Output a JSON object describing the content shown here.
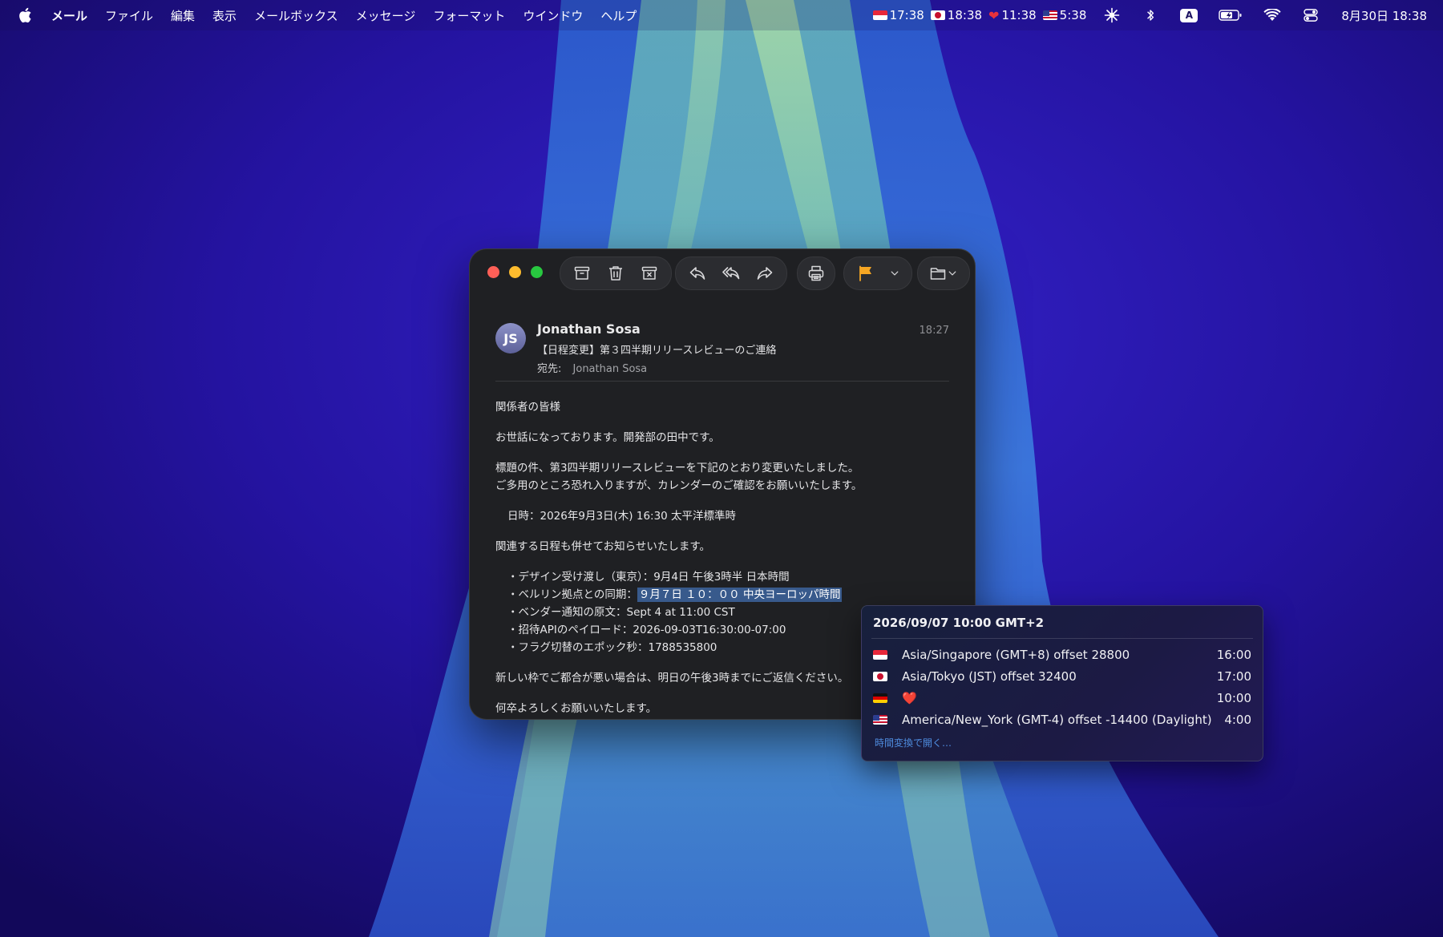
{
  "menubar": {
    "app_name": "メール",
    "items": [
      "ファイル",
      "編集",
      "表示",
      "メールボックス",
      "メッセージ",
      "フォーマット",
      "ウインドウ",
      "ヘルプ"
    ],
    "world_clocks": [
      {
        "flag": "flag-sg",
        "time": "17:38"
      },
      {
        "flag": "flag-jp",
        "time": "18:38"
      },
      {
        "flag": "heart",
        "time": "11:38"
      },
      {
        "flag": "flag-us",
        "time": "5:38"
      }
    ],
    "input_source": "A",
    "datetime": "8月30日 18:38"
  },
  "mail": {
    "sender_initials": "JS",
    "sender": "Jonathan Sosa",
    "time": "18:27",
    "subject": "【日程変更】第３四半期リリースレビューのご連絡",
    "to_label": "宛先:",
    "to_value": "Jonathan Sosa",
    "greeting": "関係者の皆様",
    "intro": "お世話になっております。開発部の田中です。",
    "para1_line1": "標題の件、第3四半期リリースレビューを下記のとおり変更いたしました。",
    "para1_line2": "ご多用のところ恐れ入りますが、カレンダーのご確認をお願いいたします。",
    "datetime_line": "日時：2026年9月3日(木) 16:30 太平洋標準時",
    "related": "関連する日程も併せてお知らせいたします。",
    "bullet1": "・デザイン受け渡し（東京）：9月4日 午後3時半 日本時間",
    "bullet2_prefix": "・ベルリン拠点との同期：",
    "bullet2_highlight": "９月７日 １０：００ 中央ヨーロッパ時間",
    "bullet3": "・ベンダー通知の原文：Sept 4 at 11:00 CST",
    "bullet4": "・招待APIのペイロード：2026-09-03T16:30:00-07:00",
    "bullet5": "・フラグ切替のエポック秒：1788535800",
    "para_reply": "新しい枠でご都合が悪い場合は、明日の午後3時までにご返信ください。",
    "closing": "何卒よろしくお願いいたします。"
  },
  "popup": {
    "title": "2026/09/07 10:00 GMT+2",
    "rows": [
      {
        "flag": "flag-sg",
        "name": "Asia/Singapore (GMT+8) offset 28800",
        "time": "16:00"
      },
      {
        "flag": "flag-jp",
        "name": "Asia/Tokyo (JST) offset 32400",
        "time": "17:00"
      },
      {
        "flag": "flag-de",
        "name": "❤️",
        "time": "10:00"
      },
      {
        "flag": "flag-us",
        "name": "America/New_York (GMT-4) offset -14400 (Daylight)",
        "time": "4:00"
      }
    ],
    "link": "時間変換で開く…"
  },
  "colors": {
    "wallpaper_base": "#150a63",
    "window_bg": "#1f2023",
    "flag_icon": "#f5a623",
    "selection": "#385a8c",
    "link": "#4f8de0"
  }
}
